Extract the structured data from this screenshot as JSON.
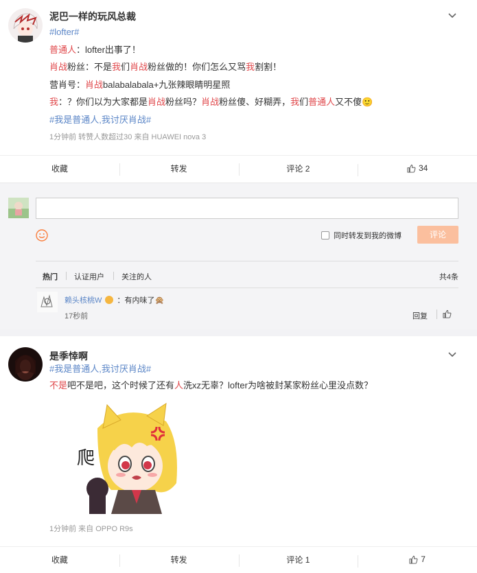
{
  "post1": {
    "author": "泥巴一样的玩风总裁",
    "lines": [
      [
        {
          "t": "#lofter#",
          "c": "blue"
        }
      ],
      [
        {
          "t": "普通人",
          "c": "red"
        },
        {
          "t": "：lofter出事了！",
          "c": ""
        }
      ],
      [
        {
          "t": "肖战",
          "c": "red"
        },
        {
          "t": "粉丝：不是",
          "c": ""
        },
        {
          "t": "我",
          "c": "red"
        },
        {
          "t": "们",
          "c": ""
        },
        {
          "t": "肖战",
          "c": "red"
        },
        {
          "t": "粉丝做的！你们怎么又骂",
          "c": ""
        },
        {
          "t": "我",
          "c": "red"
        },
        {
          "t": "割割！",
          "c": ""
        }
      ],
      [
        {
          "t": "营肖号：",
          "c": ""
        },
        {
          "t": "肖战",
          "c": "red"
        },
        {
          "t": "balabalabala+九张辣眼睛明星照",
          "c": ""
        }
      ],
      [
        {
          "t": "我",
          "c": "red"
        },
        {
          "t": "：？你们以为大家都是",
          "c": ""
        },
        {
          "t": "肖战",
          "c": "red"
        },
        {
          "t": "粉丝吗？",
          "c": ""
        },
        {
          "t": "肖战",
          "c": "red"
        },
        {
          "t": "粉丝傻、好糊弄，",
          "c": ""
        },
        {
          "t": "我",
          "c": "red"
        },
        {
          "t": "们",
          "c": ""
        },
        {
          "t": "普通人",
          "c": "red"
        },
        {
          "t": "又不傻",
          "c": ""
        },
        {
          "t": "🙂",
          "c": "emoji"
        }
      ],
      [
        {
          "t": "#我是普通人,我讨厌肖战#",
          "c": "blue"
        }
      ]
    ],
    "meta": "1分钟前  转赞人数超过30  来自 HUAWEI nova 3",
    "actions": {
      "collect": "收藏",
      "forward": "转发",
      "comment": "评论 2",
      "like": "34"
    }
  },
  "comment_box": {
    "checkbox_label": "同时转发到我的微博",
    "submit": "评论",
    "tabs": {
      "hot": "热门",
      "verified": "认证用户",
      "following": "关注的人",
      "total": "共4条"
    },
    "comment": {
      "user": "赖头核桃W",
      "text": "：有内味了🙊",
      "time": "17秒前",
      "reply": "回复"
    }
  },
  "post2": {
    "author": "是季悻啊",
    "lines": [
      [
        {
          "t": "#我是普通人,我讨厌肖战#",
          "c": "blue"
        }
      ],
      [
        {
          "t": "不是",
          "c": "red"
        },
        {
          "t": "吧不是吧，这个时候了还有",
          "c": ""
        },
        {
          "t": "人",
          "c": "red"
        },
        {
          "t": "洗xz无辜？lofter为啥被封某家粉丝心里没点数？",
          "c": ""
        }
      ]
    ],
    "image_text": "爬",
    "meta": "1分钟前  来自 OPPO R9s",
    "actions": {
      "collect": "收藏",
      "forward": "转发",
      "comment": "评论 1",
      "like": "7"
    }
  },
  "colors": {
    "red": "#e0484b",
    "blue": "#5b86c7",
    "orange": "#fa7d3c",
    "submit_bg": "#fbbf9e"
  }
}
